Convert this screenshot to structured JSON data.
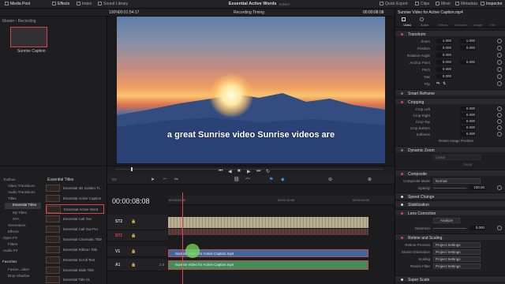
{
  "topbar": {
    "items_left": [
      {
        "label": "Media Pool",
        "icon": "media-pool-icon"
      },
      {
        "label": "Effects",
        "icon": "effects-icon"
      },
      {
        "label": "Index",
        "icon": "index-icon"
      },
      {
        "label": "Sound Library",
        "icon": "sound-library-icon"
      }
    ],
    "title": "Essential Active Words",
    "edited": "Edited",
    "items_right": [
      {
        "label": "Quick Export",
        "icon": "export-icon"
      },
      {
        "label": "Clips",
        "icon": "clips-icon"
      },
      {
        "label": "Mixer",
        "icon": "mixer-icon"
      },
      {
        "label": "Metadata",
        "icon": "metadata-icon"
      },
      {
        "label": "Inspector",
        "icon": "inspector-icon"
      }
    ]
  },
  "viewer_bar": {
    "zoom": "100%",
    "timecode_left": "00:01:54:17",
    "timing_label": "Recording Timing",
    "timecode_right": "00:00:08:08"
  },
  "media_pool": {
    "breadcrumb": "Master › Recording",
    "clip_name": "Sunrise Caption"
  },
  "viewer": {
    "caption": "a great Sunrise video Sunrise videos are"
  },
  "inspector": {
    "clip_title": "Sunrise Video for Active Caption.mp4",
    "tabs": [
      "Video",
      "Audio",
      "Effects",
      "Transition",
      "Image",
      "File"
    ],
    "sections": {
      "transform": "Transform",
      "smart_reframe": "Smart Reframe",
      "cropping": "Cropping",
      "dynamic_zoom": "Dynamic Zoom",
      "composite": "Composite",
      "speed_change": "Speed Change",
      "stabilization": "Stabilization",
      "lens_correction": "Lens Correction",
      "retime": "Retime and Scaling",
      "super_scale": "Super Scale"
    },
    "transform_rows": [
      {
        "key": "Zoom",
        "x": "1.000",
        "y": "1.000"
      },
      {
        "key": "Position",
        "x": "0.000",
        "y": "0.000"
      },
      {
        "key": "Rotation Angle",
        "x": "0.000",
        "y": ""
      },
      {
        "key": "Anchor Point",
        "x": "0.000",
        "y": "0.000"
      },
      {
        "key": "Pitch",
        "x": "0.000",
        "y": ""
      },
      {
        "key": "Yaw",
        "x": "0.000",
        "y": ""
      },
      {
        "key": "Flip",
        "x": "",
        "y": ""
      }
    ],
    "cropping_rows": [
      {
        "key": "Crop Left",
        "x": "0.000"
      },
      {
        "key": "Crop Right",
        "x": "0.000"
      },
      {
        "key": "Crop Top",
        "x": "0.000"
      },
      {
        "key": "Crop Bottom",
        "x": "0.000"
      },
      {
        "key": "Softness",
        "x": "0.000"
      }
    ],
    "retain_label": "Retain Image Position",
    "dynamic_zoom_ease": "Linear",
    "swap_label": "Swap",
    "composite_mode_label": "Composite Mode",
    "composite_mode": "Normal",
    "opacity_label": "Opacity",
    "opacity": "100.00",
    "lens_analyze": "Analyze",
    "distortion_label": "Distortion",
    "distortion": "0.000",
    "retime_rows": [
      {
        "key": "Retime Process",
        "value": "Project Settings"
      },
      {
        "key": "Motion Estimation",
        "value": "Project Settings"
      },
      {
        "key": "Scaling",
        "value": "Project Settings"
      },
      {
        "key": "Resize Filter",
        "value": "Project Settings"
      }
    ]
  },
  "effects": {
    "tree": [
      "Toolbox",
      "Video Transitions",
      "Audio Transitions",
      "Titles",
      "Essential Titles",
      "My Titles",
      "SYA",
      "Generators",
      "Effects",
      "Open FX",
      "Filters",
      "Audio FX"
    ],
    "favorites_label": "Favorites",
    "favorites": [
      "Fusion...ation",
      "Drop Shadow"
    ],
    "list_header": "Essential Titles",
    "items": [
      "Essential 3D Golden Ti...",
      "Essential Active Caption",
      "Essential Active Word",
      "Essential Call Out",
      "Essential Call Out Pro",
      "Essential Cinematic Title",
      "Essential Ribbon Title",
      "Essential Scroll Text",
      "Essential Slide Title",
      "Essential Title 01"
    ]
  },
  "timeline": {
    "timecode": "00:00:08:08",
    "ruler_marks": [
      "00:00:00:00",
      "00:01:12:00",
      "00:02:24:00"
    ],
    "tracks": [
      {
        "name": "ST2"
      },
      {
        "name": "ST1"
      },
      {
        "name": "V1"
      },
      {
        "name": "A1",
        "level": "2.0"
      }
    ],
    "video_clip": "Sunrise Video for Active Caption.mp4",
    "audio_clip": "Sunrise Video for Active Caption.mp4"
  }
}
